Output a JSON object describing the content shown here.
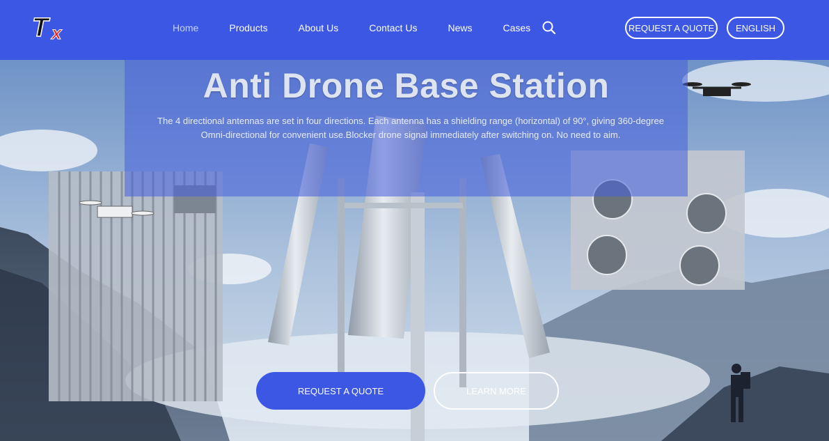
{
  "header": {
    "logo_alt": "TX",
    "nav": [
      {
        "label": "Home",
        "active": true
      },
      {
        "label": "Products"
      },
      {
        "label": "About Us"
      },
      {
        "label": "Contact Us"
      },
      {
        "label": "News"
      },
      {
        "label": "Cases"
      }
    ],
    "search_icon": "search-icon",
    "quote_label": "REQUEST A QUOTE",
    "lang_label": "ENGLISH"
  },
  "hero": {
    "title": "Anti Drone Base Station",
    "description": "The 4 directional antennas are set in four directions. Each antenna has a shielding range (horizontal) of 90°, giving 360-degree Omni-directional for convenient use.Blocker drone signal immediately after switching on. No need to aim.",
    "quote_label": "REQUEST A QUOTE",
    "learn_label": "LEARN MORE"
  },
  "colors": {
    "brand_blue": "#3b57e4",
    "white": "#ffffff"
  }
}
